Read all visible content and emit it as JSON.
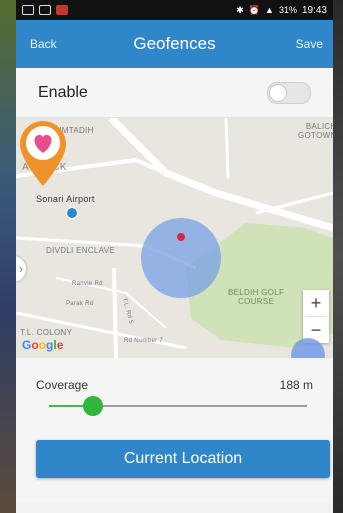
{
  "status_bar": {
    "time": "19:43",
    "battery": "31%"
  },
  "app_bar": {
    "back_label": "Back",
    "title": "Geofences",
    "save_label": "Save"
  },
  "enable": {
    "label": "Enable",
    "checked": false
  },
  "map": {
    "labels": {
      "khumtadih": "KHUMTADIH",
      "a_block": "A BLOCK",
      "balich_gotown": "BALICH\nGOTOWN",
      "sonari_airport": "Sonari Airport",
      "divdli_enclave": "DIVDLI ENCLAVE",
      "beldih_golf": "BELDIH GOLF\nCOURSE",
      "tl_colony": "T.L. COLONY",
      "road1": "Ranvie Rd",
      "road2": "Parak Rd",
      "road3": "Rd Number 7",
      "road4": "T.L. Rd 5"
    },
    "zoom_in": "+",
    "zoom_out": "−",
    "handle": "›",
    "google_letters": [
      "G",
      "o",
      "o",
      "g",
      "l",
      "e"
    ]
  },
  "coverage": {
    "label": "Coverage",
    "value": "188 m",
    "slider_fraction": 0.17
  },
  "current_location_label": "Current Location",
  "colors": {
    "primary": "#2f86c9",
    "slider": "#2db83d",
    "radius": "#78a0e6",
    "pin": "#f0922a",
    "heart": "#e94e8c"
  }
}
